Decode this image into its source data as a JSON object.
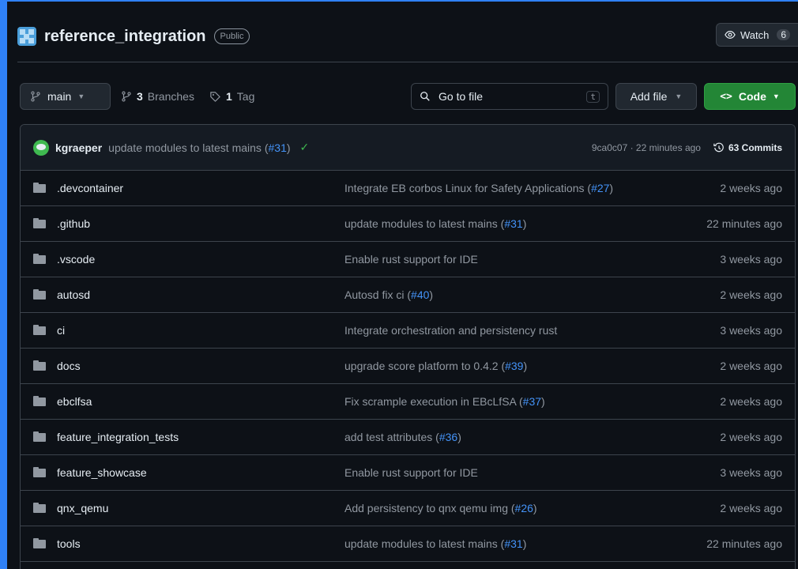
{
  "repo": {
    "name": "reference_integration",
    "visibility": "Public",
    "watch_label": "Watch",
    "watch_count": "6"
  },
  "toolbar": {
    "branch": "main",
    "branches_count": "3",
    "branches_label": "Branches",
    "tags_count": "1",
    "tags_label": "Tag",
    "search_placeholder": "Go to file",
    "search_shortcut": "t",
    "add_file_label": "Add file",
    "code_label": "Code"
  },
  "latest_commit": {
    "author": "kgraeper",
    "message": "update modules to latest mains (",
    "pr": "#31",
    "message_end": ")",
    "hash_time": "9ca0c07 · 22 minutes ago",
    "commits_label": "63 Commits"
  },
  "files": [
    {
      "name": ".devcontainer",
      "msg": "Integrate EB corbos Linux for Safety Applications (",
      "pr": "#27",
      "end": ")",
      "time": "2 weeks ago"
    },
    {
      "name": ".github",
      "msg": "update modules to latest mains (",
      "pr": "#31",
      "end": ")",
      "time": "22 minutes ago"
    },
    {
      "name": ".vscode",
      "msg": "Enable rust support for IDE",
      "pr": "",
      "end": "",
      "time": "3 weeks ago"
    },
    {
      "name": "autosd",
      "msg": "Autosd fix ci (",
      "pr": "#40",
      "end": ")",
      "time": "2 weeks ago"
    },
    {
      "name": "ci",
      "msg": "Integrate orchestration and persistency rust",
      "pr": "",
      "end": "",
      "time": "3 weeks ago"
    },
    {
      "name": "docs",
      "msg": "upgrade score platform to 0.4.2 (",
      "pr": "#39",
      "end": ")",
      "time": "2 weeks ago"
    },
    {
      "name": "ebclfsa",
      "msg": "Fix scrample execution in EBcLfSA (",
      "pr": "#37",
      "end": ")",
      "time": "2 weeks ago"
    },
    {
      "name": "feature_integration_tests",
      "msg": "add test attributes (",
      "pr": "#36",
      "end": ")",
      "time": "2 weeks ago"
    },
    {
      "name": "feature_showcase",
      "msg": "Enable rust support for IDE",
      "pr": "",
      "end": "",
      "time": "3 weeks ago"
    },
    {
      "name": "qnx_qemu",
      "msg": "Add persistency to qnx qemu img (",
      "pr": "#26",
      "end": ")",
      "time": "2 weeks ago"
    },
    {
      "name": "tools",
      "msg": "update modules to latest mains (",
      "pr": "#31",
      "end": ")",
      "time": "22 minutes ago"
    }
  ],
  "colors": {
    "background": "#0d1117",
    "border": "#3d444d",
    "link": "#4493f8",
    "code_button": "#238636",
    "success": "#3fb950",
    "frame_accent": "#2f81f7"
  }
}
